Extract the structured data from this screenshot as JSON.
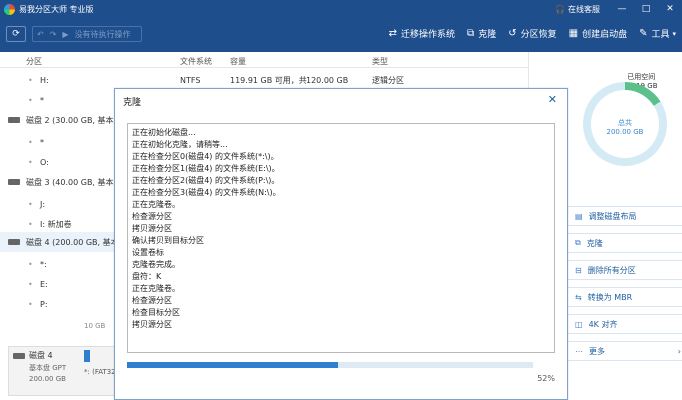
{
  "title_bar": {
    "app_title": "易我分区大师 专业版",
    "support_label": "在线客服",
    "window_controls": [
      "—",
      "□",
      "✕"
    ]
  },
  "toolbar": {
    "pending_label": "没有待执行操作",
    "items": [
      {
        "label": "迁移操作系统",
        "icon": "migrate-os-icon",
        "glyph": "⇄"
      },
      {
        "label": "克隆",
        "icon": "clone-icon",
        "glyph": "⧉"
      },
      {
        "label": "分区恢复",
        "icon": "recover-icon",
        "glyph": "↺"
      },
      {
        "label": "创建启动盘",
        "icon": "bootdisk-icon",
        "glyph": "▦"
      },
      {
        "label": "工具",
        "icon": "tools-icon",
        "glyph": "✎"
      }
    ]
  },
  "table": {
    "headers": [
      "分区",
      "文件系统",
      "容量",
      "类型"
    ],
    "rows": [
      {
        "name": "H:",
        "fs": "NTFS",
        "capacity": "119.91 GB 可用，共",
        "capacity2": "120.00 GB",
        "type": "逻辑分区"
      },
      {
        "name": "*",
        "fs": "",
        "capacity": "",
        "capacity2": "",
        "type": ""
      },
      {
        "name": "磁盘 2 (30.00 GB, 基本盘",
        "disk": true
      },
      {
        "name": "*",
        "fs": "",
        "capacity": "",
        "capacity2": "",
        "type": ""
      },
      {
        "name": "O:",
        "fs": "",
        "capacity": "",
        "capacity2": "",
        "type": ""
      },
      {
        "name": "磁盘 3 (40.00 GB, 基本盘",
        "disk": true
      },
      {
        "name": "J:",
        "fs": "",
        "capacity": "",
        "capacity2": "",
        "type": ""
      },
      {
        "name": "I: 新加卷",
        "fs": "",
        "capacity": "",
        "capacity2": "",
        "type": ""
      },
      {
        "name": "磁盘 4 (200.00 GB, 基本",
        "disk": true
      },
      {
        "name": "*:",
        "fs": "",
        "capacity": "",
        "capacity2": "",
        "type": ""
      },
      {
        "name": "E:",
        "fs": "",
        "capacity": "",
        "capacity2": "",
        "type": ""
      },
      {
        "name": "P:",
        "fs": "",
        "capacity": "",
        "capacity2": "",
        "type": ""
      }
    ],
    "bottom_size": "10 GB"
  },
  "bottom_disk": {
    "name": "磁盘 4",
    "type": "基本盘 GPT",
    "size": "200.00 GB",
    "partition": "*: (FAT32"
  },
  "right_panel": {
    "used_label": "已用空间",
    "used_value": "32.19 GB",
    "total_label": "总共",
    "total_value": "200.00 GB",
    "used_fraction": 0.16,
    "actions": [
      {
        "label": "调整磁盘布局",
        "icon": "layout-icon",
        "glyph": "▤"
      },
      {
        "label": "克隆",
        "icon": "clone-icon",
        "glyph": "⧉"
      },
      {
        "label": "删除所有分区",
        "icon": "delete-icon",
        "glyph": "⊟"
      },
      {
        "label": "转换为 MBR",
        "icon": "convert-icon",
        "glyph": "⇆"
      },
      {
        "label": "4K 对齐",
        "icon": "align-icon",
        "glyph": "◫"
      },
      {
        "label": "更多",
        "icon": "more-icon",
        "glyph": "⋯"
      }
    ]
  },
  "modal": {
    "title": "克隆",
    "log": [
      "正在初始化磁盘...",
      "正在初始化克隆，请稍等...",
      "正在检查分区0(磁盘4) 的文件系统(*:\\)。",
      "正在检查分区1(磁盘4) 的文件系统(E:\\)。",
      "正在检查分区2(磁盘4) 的文件系统(P:\\)。",
      "正在检查分区3(磁盘4) 的文件系统(N:\\)。",
      "正在克隆卷。",
      "检查源分区",
      "拷贝源分区",
      "确认拷贝到目标分区",
      "设置卷标",
      "克隆卷完成。",
      "盘符：K",
      "正在克隆卷。",
      "检查源分区",
      "检查目标分区",
      "拷贝源分区"
    ],
    "progress_fraction": 0.52,
    "percent_text": "52%"
  },
  "colors": {
    "titlebar": "#1f4e8c",
    "accent": "#2f7fd1",
    "used": "#5cc08a"
  }
}
